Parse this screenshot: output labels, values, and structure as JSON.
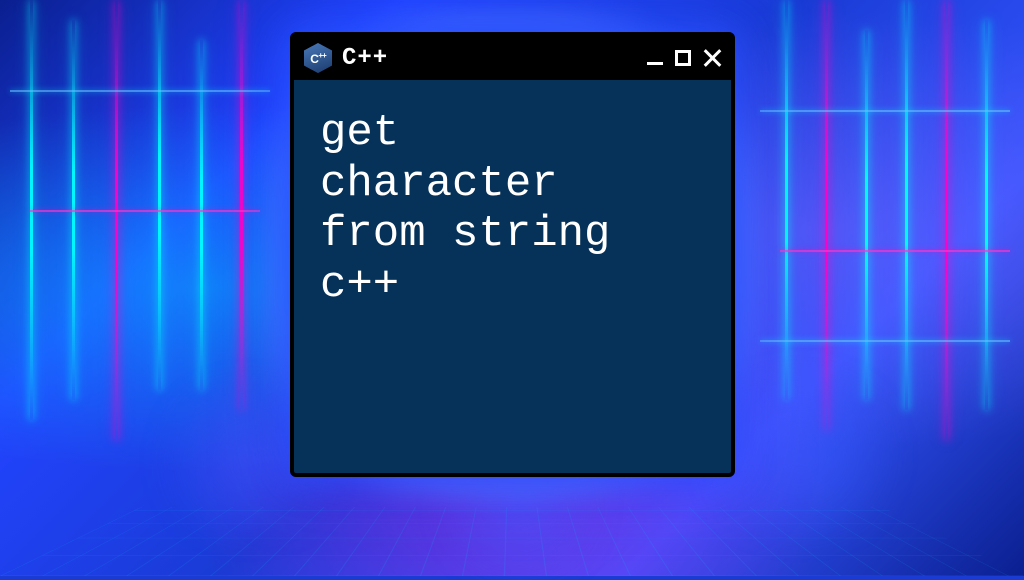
{
  "window": {
    "icon_label": "C",
    "icon_plus": "++",
    "title": "C++",
    "controls": {
      "minimize": "minimize",
      "maximize": "maximize",
      "close": "close"
    }
  },
  "content": {
    "text": "get\ncharacter\nfrom string\nc++"
  }
}
